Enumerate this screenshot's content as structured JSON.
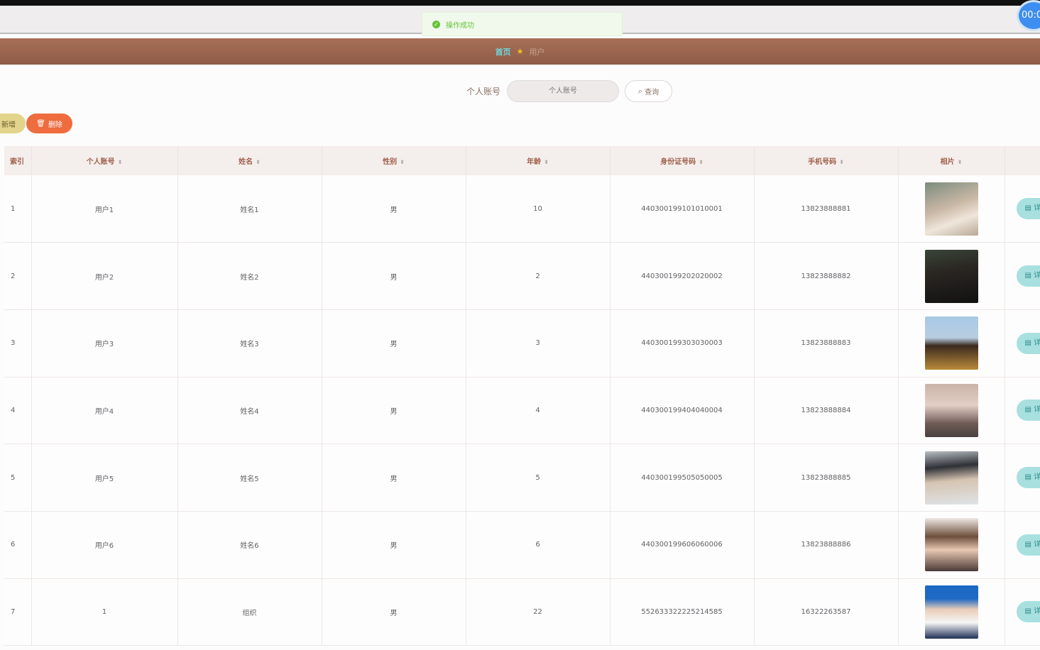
{
  "toast": {
    "message": "操作成功"
  },
  "clock": {
    "text": "00:0"
  },
  "breadcrumb": {
    "home": "首页",
    "current": "用户"
  },
  "search": {
    "label": "个人账号",
    "placeholder": "个人账号",
    "button": "查询"
  },
  "actions": {
    "add": "新增",
    "delete": "删除"
  },
  "table": {
    "headers": [
      "索引",
      "个人账号",
      "姓名",
      "性别",
      "年龄",
      "身份证号码",
      "手机号码",
      "相片"
    ],
    "detail_label": "详",
    "rows": [
      {
        "index": "1",
        "account": "用户1",
        "name": "姓名1",
        "gender": "男",
        "age": "10",
        "id_number": "440300199101010001",
        "phone": "13823888881"
      },
      {
        "index": "2",
        "account": "用户2",
        "name": "姓名2",
        "gender": "男",
        "age": "2",
        "id_number": "440300199202020002",
        "phone": "13823888882"
      },
      {
        "index": "3",
        "account": "用户3",
        "name": "姓名3",
        "gender": "男",
        "age": "3",
        "id_number": "440300199303030003",
        "phone": "13823888883"
      },
      {
        "index": "4",
        "account": "用户4",
        "name": "姓名4",
        "gender": "男",
        "age": "4",
        "id_number": "440300199404040004",
        "phone": "13823888884"
      },
      {
        "index": "5",
        "account": "用户5",
        "name": "姓名5",
        "gender": "男",
        "age": "5",
        "id_number": "440300199505050005",
        "phone": "13823888885"
      },
      {
        "index": "6",
        "account": "用户6",
        "name": "姓名6",
        "gender": "男",
        "age": "6",
        "id_number": "440300199606060006",
        "phone": "13823888886"
      },
      {
        "index": "7",
        "account": "1",
        "name": "组织",
        "gender": "男",
        "age": "22",
        "id_number": "552633322225214585",
        "phone": "16322263587"
      }
    ]
  }
}
